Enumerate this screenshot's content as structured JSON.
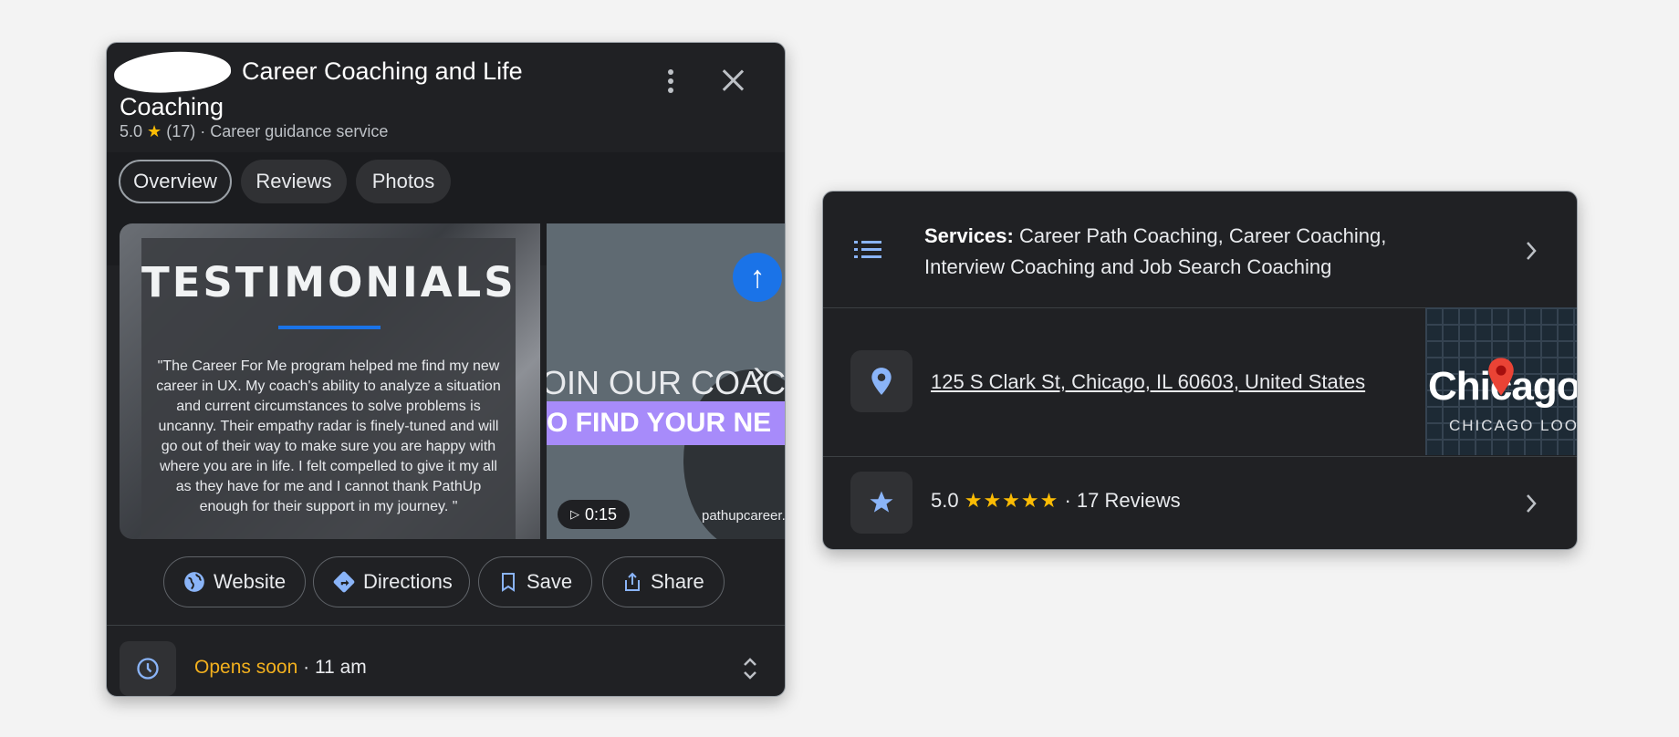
{
  "left_card": {
    "title": "Career Coaching and Life Coaching",
    "rating": "5.0",
    "star": "★",
    "review_count": "(17)",
    "separator": "·",
    "category": "Career guidance service",
    "tabs": [
      {
        "label": "Overview",
        "active": true
      },
      {
        "label": "Reviews",
        "active": false
      },
      {
        "label": "Photos",
        "active": false
      }
    ],
    "media": {
      "testimonial_title": "TESTIMONIALS",
      "testimonial_text": "\"The Career For Me program helped me find my new career in UX. My coach's ability to analyze a situation and current circumstances to solve problems is uncanny. Their empathy radar is finely-tuned and will go out of their way to make sure you are happy with where you are in life. I felt compelled to give it my all as they have for me and I cannot thank PathUp enough for their support in my journey. \"",
      "video_text_1": "OIN OUR COACH",
      "video_text_2": "O FIND YOUR NE",
      "video_duration": "0:15",
      "video_domain": "pathupcareer."
    },
    "actions": [
      {
        "label": "Website",
        "icon": "globe-icon"
      },
      {
        "label": "Directions",
        "icon": "directions-icon"
      },
      {
        "label": "Save",
        "icon": "bookmark-icon"
      },
      {
        "label": "Share",
        "icon": "share-icon"
      }
    ],
    "hours": {
      "status": "Opens soon",
      "separator": "·",
      "time": "11 am"
    }
  },
  "right_card": {
    "services_label": "Services:",
    "services_value": "Career Path Coaching, Career Coaching, Interview Coaching and Job Search Coaching",
    "address": "125 S Clark St, Chicago, IL 60603, United States",
    "map_label": "Chicago",
    "map_sublabel": "CHICAGO LOO",
    "rating": "5.0",
    "stars": "★★★★★",
    "separator": "·",
    "reviews": "17 Reviews"
  },
  "colors": {
    "card_bg": "#202124",
    "accent_blue": "#8ab4f8",
    "star_yellow": "#fbbc04",
    "opens_soon": "#f2b01e",
    "map_pin": "#ea4335"
  }
}
